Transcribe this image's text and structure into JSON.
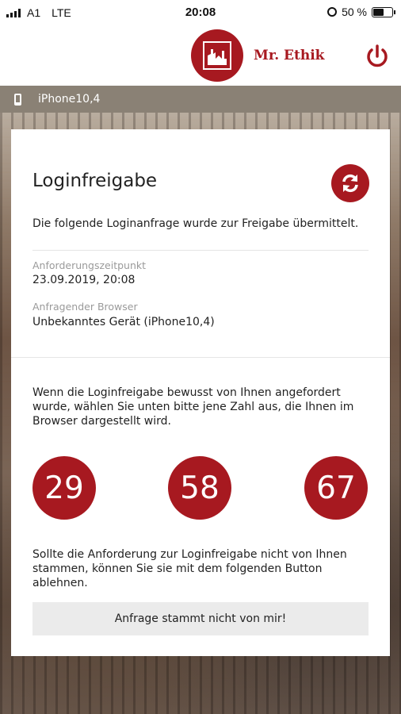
{
  "status_bar": {
    "carrier": "A1",
    "network": "LTE",
    "time": "20:08",
    "battery": "50 %"
  },
  "header": {
    "brand": "Mr. Ethik",
    "logo_icon": "building-logo-icon",
    "power_icon": "power-icon"
  },
  "device_bar": {
    "label": "iPhone10,4",
    "icon": "phone-icon"
  },
  "card": {
    "title": "Loginfreigabe",
    "refresh_icon": "refresh-icon",
    "intro": "Die folgende Loginanfrage wurde zur Freigabe übermittelt.",
    "request_time_label": "Anforderungszeitpunkt",
    "request_time_value": "23.09.2019, 20:08",
    "browser_label": "Anfragender Browser",
    "browser_value": "Unbekanntes Gerät (iPhone10,4)",
    "instruction": "Wenn die Loginfreigabe bewusst von Ihnen angefordert wurde, wählen Sie unten bitte jene Zahl aus, die Ihnen im Browser dargestellt wird.",
    "numbers": [
      "29",
      "58",
      "67"
    ],
    "reject_text": "Sollte die Anforderung zur Loginfreigabe nicht von Ihnen stammen, können Sie sie mit dem folgenden Button ablehnen.",
    "reject_button": "Anfrage stammt nicht von mir!"
  },
  "colors": {
    "accent": "#a71920",
    "device_bar": "#8a8175",
    "button_bg": "#ebebeb"
  }
}
